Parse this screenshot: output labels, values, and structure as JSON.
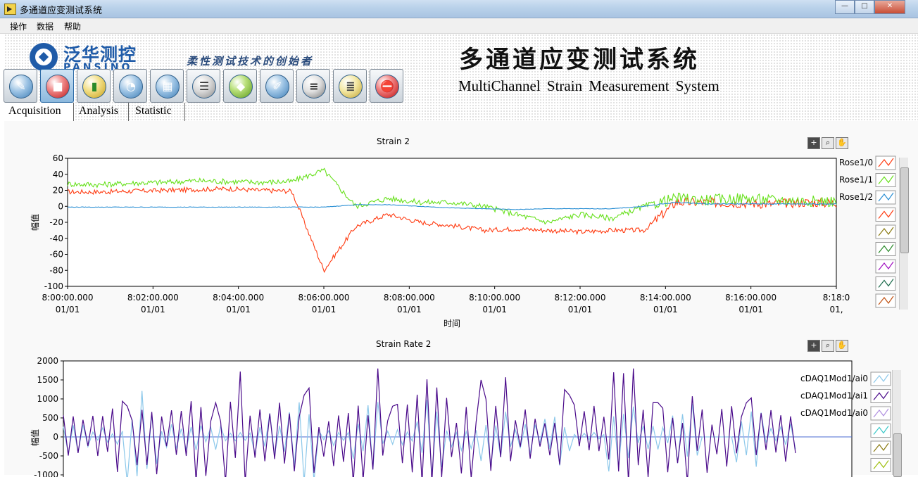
{
  "window": {
    "title": "多通道应变测试系统"
  },
  "menu": [
    "操作",
    "数据",
    "帮助"
  ],
  "header": {
    "logo_cn": "泛华测控",
    "logo_en": "PANSINO",
    "slogan": "柔性测试技术的创始者",
    "system_cn": "多通道应变测试系统",
    "system_en": "MultiChannel  Strain  Measurement  System"
  },
  "toolbar": {
    "buttons": [
      {
        "icon": "tools-icon"
      },
      {
        "icon": "record-icon",
        "active": true
      },
      {
        "icon": "bar-chart-icon"
      },
      {
        "icon": "gauge-icon"
      },
      {
        "icon": "table-icon"
      },
      {
        "icon": "report-icon"
      },
      {
        "icon": "stack-icon"
      },
      {
        "icon": "edit-icon"
      },
      {
        "icon": "list-icon"
      },
      {
        "icon": "notes-icon"
      },
      {
        "icon": "stop-icon"
      }
    ]
  },
  "tabs": [
    "Acquisition",
    "Analysis",
    "Statistic"
  ],
  "colors": {
    "red": "#ff3a10",
    "green": "#66e01a",
    "blue": "#2a8fd4",
    "purple": "#4a0a8a",
    "lightblue": "#8cc8ea"
  },
  "chart_data": [
    {
      "type": "line",
      "title": "Strain 2",
      "xlabel": "时间",
      "ylabel": "幅值",
      "ylim": [
        -100,
        60
      ],
      "yticks": [
        "60",
        "40",
        "20",
        "0",
        "-20",
        "-40",
        "-60",
        "-80",
        "-100"
      ],
      "xticks_time": [
        "8:00:00.000",
        "8:02:00.000",
        "8:04:00.000",
        "8:06:00.000",
        "8:08:00.000",
        "8:10:00.000",
        "8:12:00.000",
        "8:14:00.000",
        "8:16:00.000",
        "8:18:0"
      ],
      "xticks_date": [
        "01/01",
        "01/01",
        "01/01",
        "01/01",
        "01/01",
        "01/01",
        "01/01",
        "01/01",
        "01/01",
        "01,"
      ],
      "legend": [
        "Rose1/0",
        "Rose1/1",
        "Rose1/2"
      ],
      "series": [
        {
          "name": "Rose1/0",
          "values": [
            18,
            18,
            19,
            20,
            21,
            22,
            20,
            19,
            -80,
            -25,
            -10,
            -20,
            -24,
            -30,
            -28,
            -30,
            -32,
            -30,
            -30,
            5,
            5,
            4,
            3,
            5,
            4
          ]
        },
        {
          "name": "Rose1/1",
          "values": [
            28,
            27,
            29,
            30,
            32,
            31,
            30,
            31,
            45,
            0,
            10,
            5,
            5,
            0,
            -10,
            -20,
            -10,
            -15,
            0,
            10,
            8,
            10,
            8,
            7,
            6
          ]
        },
        {
          "name": "Rose1/2",
          "values": [
            -1,
            -1,
            -1,
            -1,
            -1,
            -1,
            -1,
            -1,
            -1,
            2,
            2,
            0,
            -2,
            -3,
            -4,
            -3,
            -3,
            -3,
            0,
            5,
            3,
            3,
            3,
            3,
            3
          ]
        }
      ]
    },
    {
      "type": "line",
      "title": "Strain Rate 2",
      "ylabel": "幅值",
      "ylim": [
        -1000,
        2000
      ],
      "yticks": [
        "2000",
        "1500",
        "1000",
        "500",
        "0",
        "-500",
        "-1000"
      ],
      "legend": [
        "cDAQ1Mod1/ai0",
        "cDAQ1Mod1/ai1",
        "cDAQ1Mod1/ai0"
      ],
      "series": [
        {
          "name": "cDAQ1Mod1/ai0",
          "color_key": "lightblue",
          "values": [
            -400,
            200,
            1200,
            -300,
            300,
            -100,
            600,
            1100,
            -200,
            900,
            200,
            1000,
            -300,
            800,
            -500,
            700,
            100,
            900,
            300,
            1100,
            0,
            700,
            -300,
            500
          ]
        },
        {
          "name": "cDAQ1Mod1/ai1",
          "color_key": "purple",
          "values": [
            -500,
            800,
            -900,
            700,
            -1000,
            1500,
            -800,
            1100,
            -700,
            1700,
            -900,
            1300,
            -1000,
            1500,
            -800,
            1100,
            -700,
            1700,
            -1000,
            1200,
            -800,
            900,
            -600,
            500
          ]
        }
      ]
    }
  ]
}
